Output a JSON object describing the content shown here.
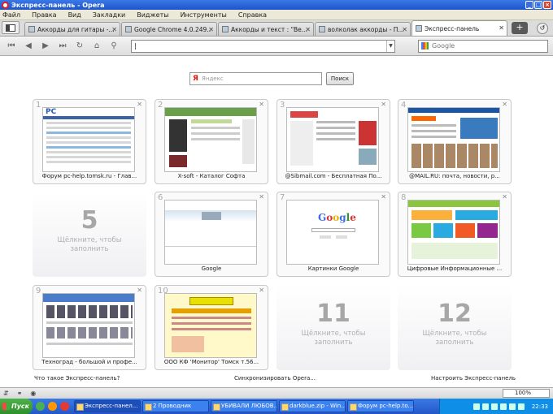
{
  "window": {
    "title": "Экспресс-панель - Opera"
  },
  "menu": [
    "Файл",
    "Правка",
    "Вид",
    "Закладки",
    "Виджеты",
    "Инструменты",
    "Справка"
  ],
  "tabs": [
    {
      "label": "Аккорды для гитары -..."
    },
    {
      "label": "Google Chrome 4.0.249...."
    },
    {
      "label": "Аккорды и текст : \"Ве..."
    },
    {
      "label": "волколак аккорды - П..."
    },
    {
      "label": "Экспресс-панель"
    }
  ],
  "address": {
    "value": "|"
  },
  "search": {
    "placeholder": "Google"
  },
  "yandex": {
    "placeholder": "Яндекс",
    "button": "Поиск"
  },
  "dials": [
    {
      "num": "1",
      "caption": "Форум pc-help.tomsk.ru - Глав..."
    },
    {
      "num": "2",
      "caption": "X-soft - Каталог Софта"
    },
    {
      "num": "3",
      "caption": "@Sibmail.com - Бесплатная По..."
    },
    {
      "num": "4",
      "caption": "@MAIL.RU: почта, новости, р..."
    },
    {
      "num": "5",
      "hint1": "Щёлкните, чтобы",
      "hint2": "заполнить"
    },
    {
      "num": "6",
      "caption": "Google"
    },
    {
      "num": "7",
      "caption": "Картинки Google"
    },
    {
      "num": "8",
      "caption": "Цифровые Информационные ..."
    },
    {
      "num": "9",
      "caption": "Техноград - большой и профе..."
    },
    {
      "num": "10",
      "caption": "ООО КФ 'Монитор' Томск т.56..."
    },
    {
      "num": "11",
      "hint1": "Щёлкните, чтобы",
      "hint2": "заполнить"
    },
    {
      "num": "12",
      "hint1": "Щёлкните, чтобы",
      "hint2": "заполнить"
    }
  ],
  "footer": {
    "what": "Что такое Экспресс-панель?",
    "sync": "Синхронизировать Opera...",
    "setup": "Настроить Экспресс-панель"
  },
  "status": {
    "zoom": "100%"
  },
  "taskbar": {
    "start": "Пуск",
    "buttons": [
      "Экспресс-панел...",
      "2 Проводник",
      "УБИВАЛИ ЛЮБОВ...",
      "darkblue.zip - Win...",
      "Форум pc-help.to..."
    ],
    "clock": "22:33"
  }
}
